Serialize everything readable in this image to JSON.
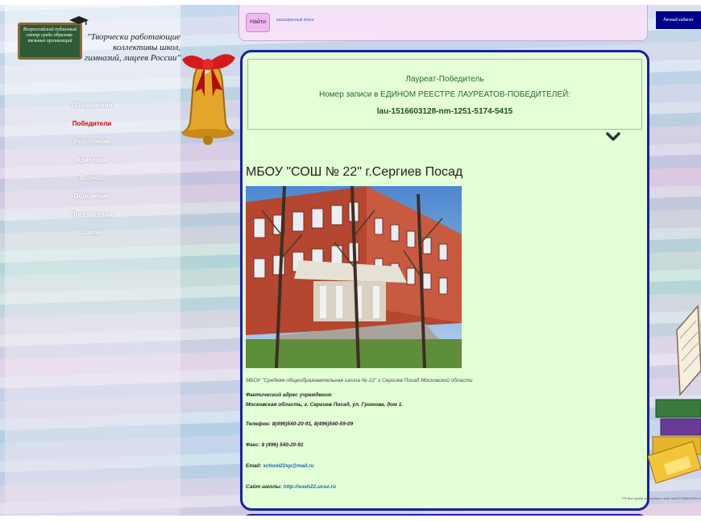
{
  "logo": {
    "text": "Всероссийский публичный смотр среди образова-тельных организаций"
  },
  "tagline": "\"Творчески работающие коллективы школ, гимназий, лицеев России\"",
  "nav": {
    "items": [
      {
        "label": "Объявления",
        "active": false
      },
      {
        "label": "Победители",
        "active": true
      },
      {
        "label": "Участникам",
        "active": false
      },
      {
        "label": "Критерии",
        "active": false
      },
      {
        "label": "Формат",
        "active": false
      },
      {
        "label": "Положение",
        "active": false
      },
      {
        "label": "Посетителям",
        "active": false
      },
      {
        "label": "Связь",
        "active": false
      }
    ]
  },
  "search": {
    "button_label": "Найти",
    "advanced_link": "расширенный поиск"
  },
  "header": {
    "cabinet_label": "Личный кабинет"
  },
  "laureate": {
    "line1": "Лауреат-Победитель",
    "line2": "Номер записи в ЕДИНОМ РЕЕСТРЕ ЛАУРЕАТОВ-ПОБЕДИТЕЛЕЙ:",
    "record_id": "lau-1516603128-nm-1251-5174-5415"
  },
  "school": {
    "title": "МБОУ \"СОШ № 22\" г.Сергиев Посад",
    "caption": "МБОУ \"Средняя общеобразовательная школа № 22\"  г.Сергиев Посад Московской области",
    "address_label": "Фактический адрес  учреждения:",
    "address": "Московская область, г. Сергиев Посад, ул. Громова, дом 1.",
    "phone_label": "Телефон:",
    "phone": "8(496)540-20-91, 8(496)540-59-09",
    "fax_label": "Факс:",
    "fax": "8 (496) 540-20-91",
    "email_label": "Email:",
    "email": "school22sp@mail.ru",
    "site_label": "Сайт школы:",
    "site": "http://sosh22.ucoz.ru"
  },
  "footer": {
    "text": "РФ Все права защищены e-mail: tks2017@tks2000.ru"
  },
  "colors": {
    "card_bg": "#e3ffd6",
    "card_border": "#1b1fa6",
    "active_nav": "#d40000",
    "cabinet_bg": "#00008b"
  }
}
